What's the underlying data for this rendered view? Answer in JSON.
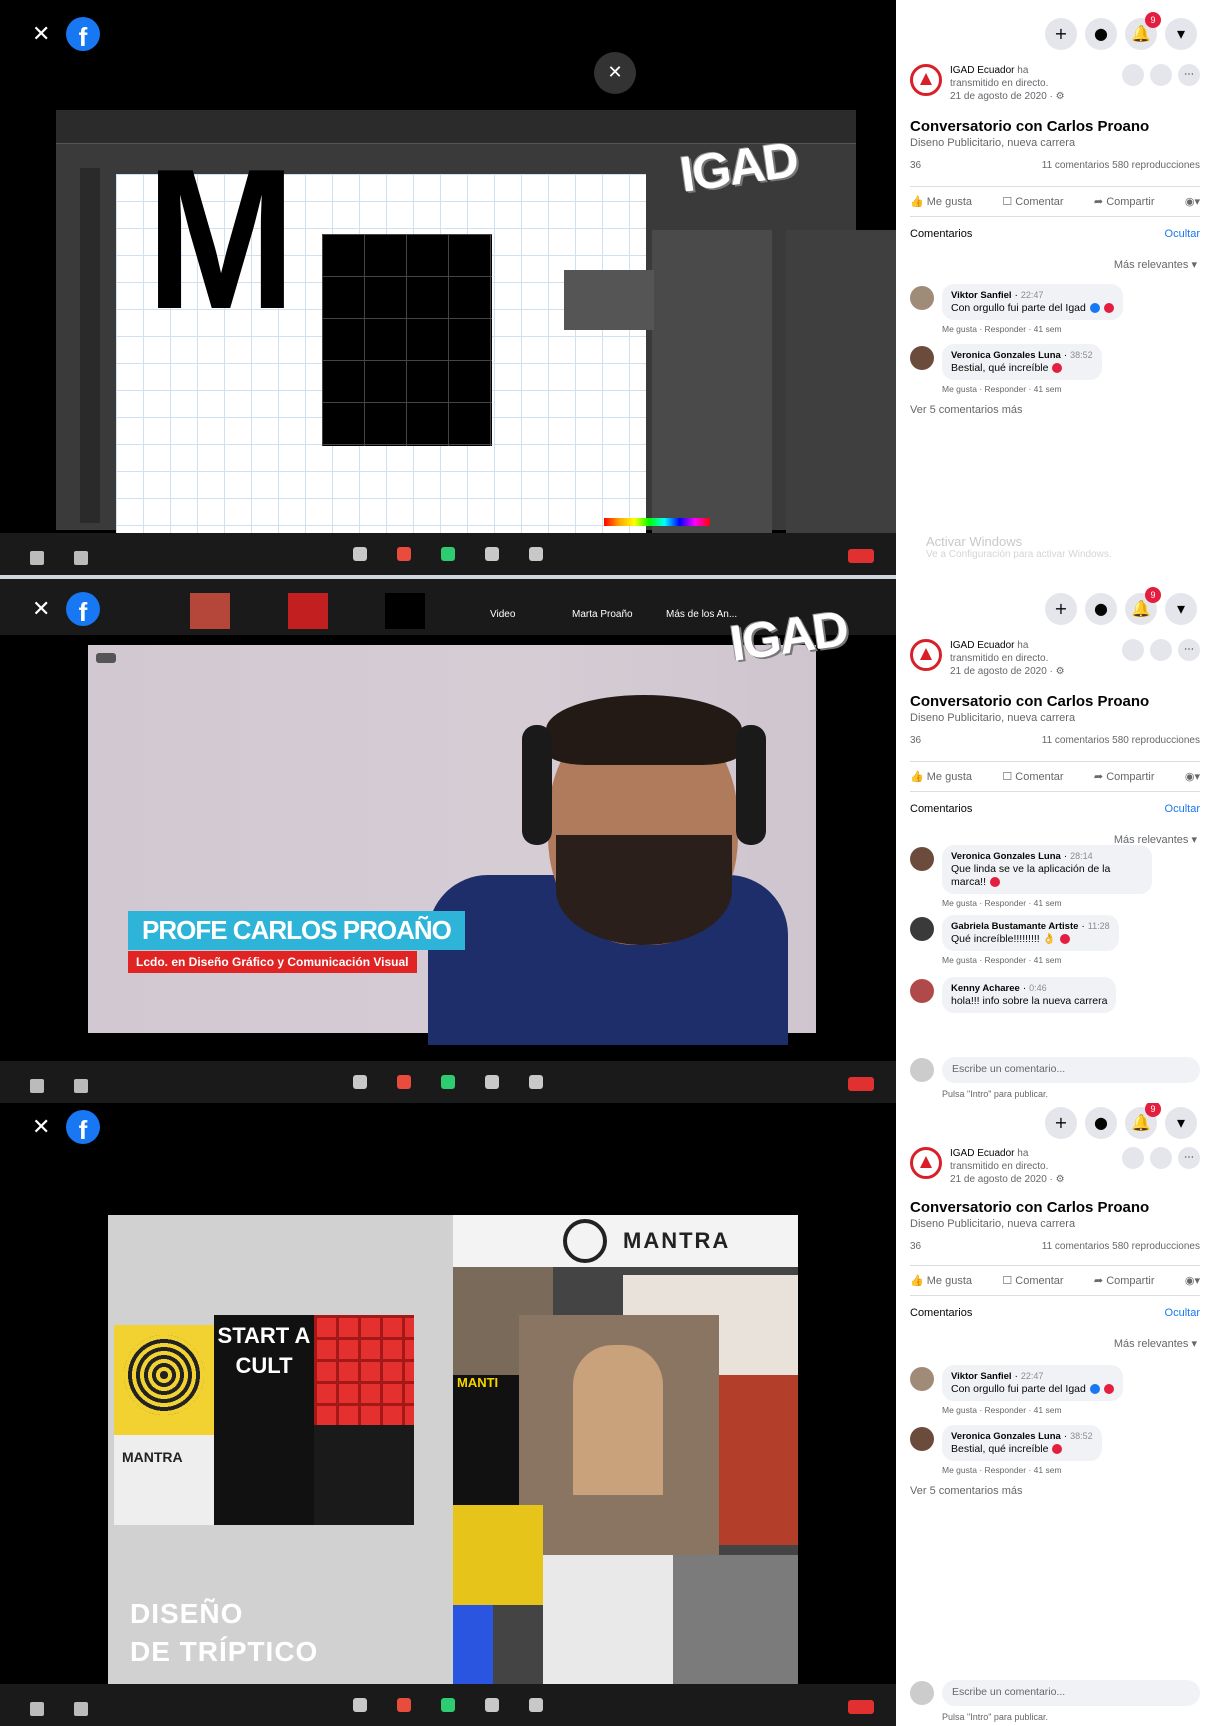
{
  "comments_title_hide": "Ocultar",
  "panels": [
    {
      "post": {
        "page_name": "IGAD Ecuador",
        "line1_suffix": " ha",
        "line2": "transmitido en directo.",
        "date": "21 de agosto de 2020 · ⚙",
        "title": "Conversatorio con Carlos Proano",
        "subtitle": "Diseno Publicitario, nueva carrera",
        "stats_left": "36",
        "stats_right": "11 comentarios  580 reproducciones",
        "like": "Me gusta",
        "comment": "Comentar",
        "share": "Compartir",
        "comments_label": "Comentarios",
        "sort_label": "Más relevantes ▾",
        "more_comments": "Ver 5 comentarios más",
        "comments": [
          {
            "name": "Viktor Sanfiel",
            "time": "22:47",
            "text": "Con orgullo fui parte del Igad",
            "meta": "Me gusta · Responder · 41 sem"
          },
          {
            "name": "Veronica Gonzales Luna",
            "time": "38:52",
            "text": "Bestial, qué increíble",
            "meta": "Me gusta · Responder · 41 sem"
          }
        ]
      },
      "activate": {
        "title": "Activar Windows",
        "sub": "Ve a Configuración para activar Windows."
      },
      "notif_count": "9"
    },
    {
      "post": {
        "page_name": "IGAD Ecuador",
        "line1_suffix": " ha",
        "line2": "transmitido en directo.",
        "date": "21 de agosto de 2020 · ⚙",
        "title": "Conversatorio con Carlos Proano",
        "subtitle": "Diseno Publicitario, nueva carrera",
        "stats_left": "36",
        "stats_right": "11 comentarios  580 reproducciones",
        "like": "Me gusta",
        "comment": "Comentar",
        "share": "Compartir",
        "comments_label": "Comentarios",
        "sort_label": "Más relevantes ▾",
        "comments": [
          {
            "name": "Veronica Gonzales Luna",
            "time": "28:14",
            "text": "Que linda se ve la aplicación de la marca!!",
            "meta": "Me gusta · Responder · 41 sem"
          },
          {
            "name": "Gabriela Bustamante Artiste",
            "time": "11:28",
            "text": "Qué increíble!!!!!!!!! 👌",
            "meta": "Me gusta · Responder · 41 sem"
          },
          {
            "name": "Kenny Acharee",
            "time": "0:46",
            "text": "hola!!! info sobre la nueva carrera",
            "meta": ""
          }
        ],
        "write_placeholder": "Escribe un comentario...",
        "write_hint": "Pulsa \"Intro\" para publicar."
      },
      "notif_count": "9",
      "lower_third": {
        "name": "PROFE CARLOS PROAÑO",
        "role": "Lcdo. en Diseño Gráfico y Comunicación Visual"
      },
      "zoom_labels": [
        "Video",
        "Marta Proaño",
        "Más de los An..."
      ]
    },
    {
      "post": {
        "page_name": "IGAD Ecuador",
        "line1_suffix": " ha",
        "line2": "transmitido en directo.",
        "date": "21 de agosto de 2020 · ⚙",
        "title": "Conversatorio con Carlos Proano",
        "subtitle": "Diseno Publicitario, nueva carrera",
        "stats_left": "36",
        "stats_right": "11 comentarios  580 reproducciones",
        "like": "Me gusta",
        "comment": "Comentar",
        "share": "Compartir",
        "comments_label": "Comentarios",
        "sort_label": "Más relevantes ▾",
        "more_comments": "Ver 5 comentarios más",
        "comments": [
          {
            "name": "Viktor Sanfiel",
            "time": "22:47",
            "text": "Con orgullo fui parte del Igad",
            "meta": "Me gusta · Responder · 41 sem"
          },
          {
            "name": "Veronica Gonzales Luna",
            "time": "38:52",
            "text": "Bestial, qué increíble",
            "meta": "Me gusta · Responder · 41 sem"
          }
        ],
        "write_placeholder": "Escribe un comentario...",
        "write_hint": "Pulsa \"Intro\" para publicar."
      },
      "notif_count": "9",
      "slide": {
        "mantra": "MANTRA",
        "start_cult": "START A CULT",
        "design_title_1": "DISEÑO",
        "design_title_2": "DE TRÍPTICO",
        "strip_word": "MANTI"
      }
    }
  ],
  "watermark": "IGAD"
}
